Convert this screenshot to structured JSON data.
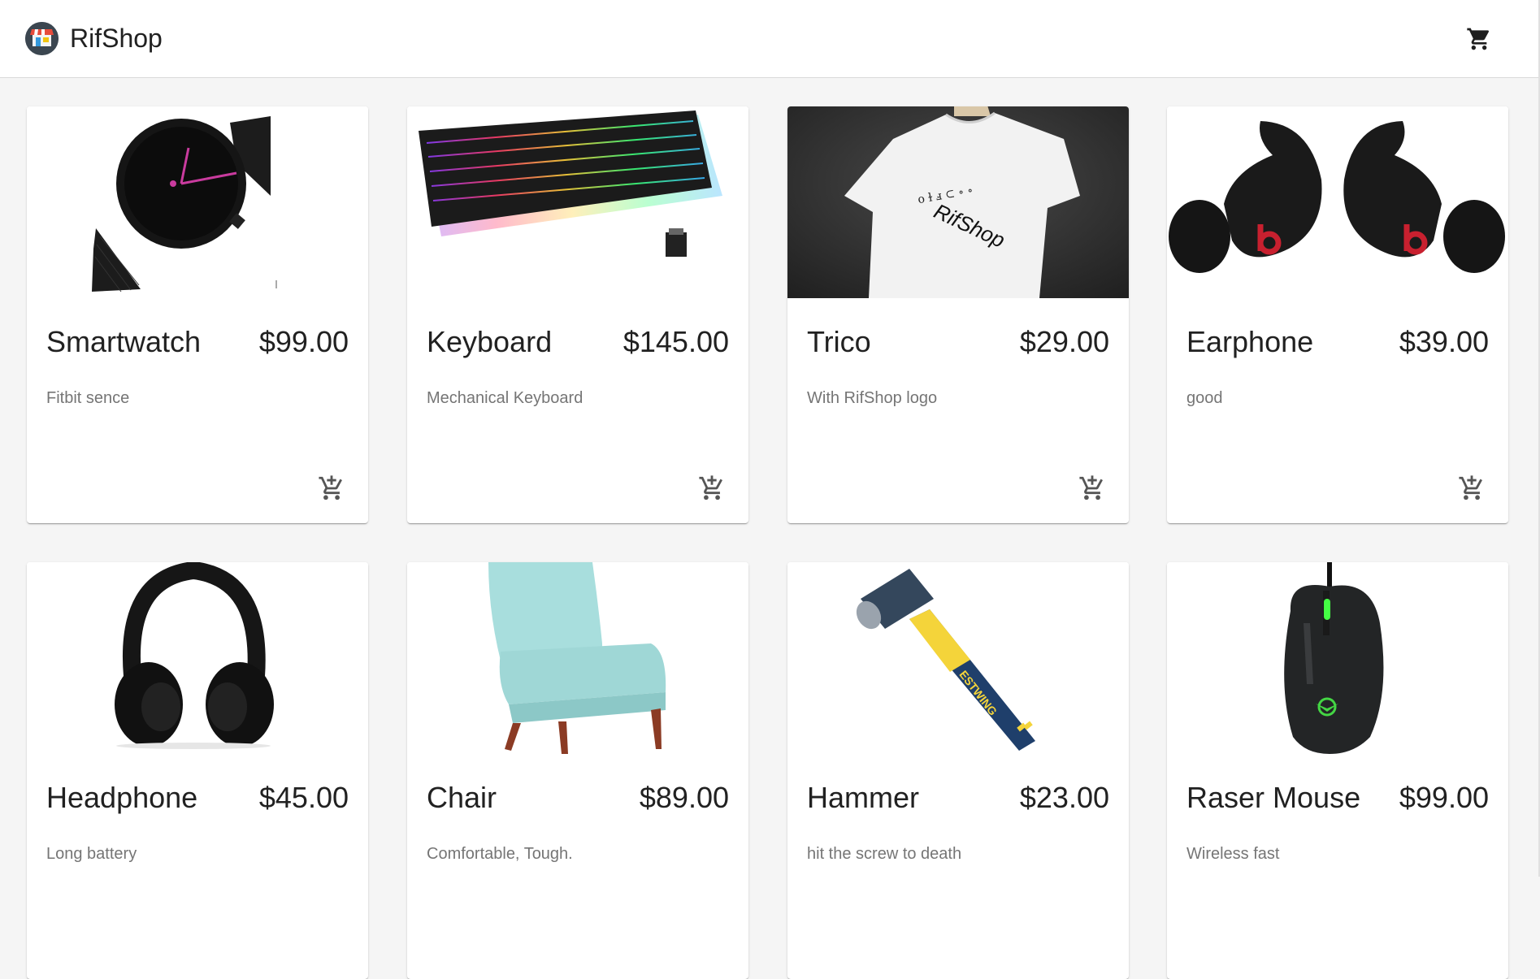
{
  "header": {
    "brand": "RifShop",
    "logo_icon": "shop-storefront-icon",
    "cart_icon": "shopping-cart-icon"
  },
  "colors": {
    "appbar_bg": "#ffffff",
    "page_bg": "#f5f5f5",
    "text_primary": "#212121",
    "text_secondary": "#757575"
  },
  "products": [
    {
      "name": "Smartwatch",
      "price": "$99.00",
      "description": "Fitbit sence",
      "image": "smartwatch-image",
      "action_icon": "add-shopping-cart-icon"
    },
    {
      "name": "Keyboard",
      "price": "$145.00",
      "description": "Mechanical Keyboard",
      "image": "keyboard-image",
      "action_icon": "add-shopping-cart-icon"
    },
    {
      "name": "Trico",
      "price": "$29.00",
      "description": "With RifShop logo",
      "image": "tshirt-image",
      "image_text": "RifShop",
      "action_icon": "add-shopping-cart-icon"
    },
    {
      "name": "Earphone",
      "price": "$39.00",
      "description": "good",
      "image": "earphone-image",
      "action_icon": "add-shopping-cart-icon"
    },
    {
      "name": "Headphone",
      "price": "$45.00",
      "description": "Long battery",
      "image": "headphone-image",
      "action_icon": "add-shopping-cart-icon"
    },
    {
      "name": "Chair",
      "price": "$89.00",
      "description": "Comfortable, Tough.",
      "image": "chair-image",
      "action_icon": "add-shopping-cart-icon"
    },
    {
      "name": "Hammer",
      "price": "$23.00",
      "description": "hit the screw to death",
      "image": "hammer-image",
      "image_text": "ESTWING",
      "action_icon": "add-shopping-cart-icon"
    },
    {
      "name": "Raser Mouse",
      "price": "$99.00",
      "description": "Wireless fast",
      "image": "mouse-image",
      "action_icon": "add-shopping-cart-icon"
    }
  ]
}
